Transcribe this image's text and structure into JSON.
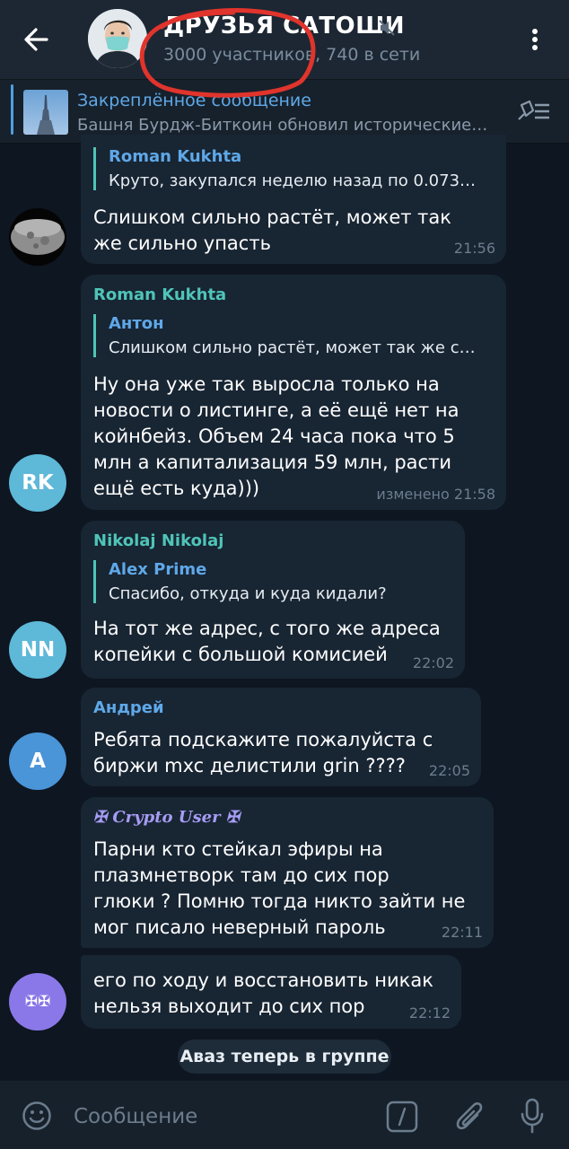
{
  "header": {
    "title": "ДРУЗЬЯ САТОШИ",
    "subtitle": "3000 участников, 740 в сети",
    "back_icon": "arrow-left-icon",
    "muted_icon": "muted-speaker-icon",
    "menu_icon": "more-vertical-icon"
  },
  "pinned": {
    "title": "Закреплённое сообщение",
    "text": "Башня Бурдж-Биткоин обновил исторические…"
  },
  "messages": [
    {
      "sender": "",
      "reply_name": "Roman Kukhta",
      "reply_text": "Круто, закупался неделю назад по 0.073…",
      "text": "Слишком сильно растёт, может так\nже сильно упасть",
      "time": "21:56",
      "avatar_initials": ""
    },
    {
      "sender": "Roman Kukhta",
      "reply_name": "Антон",
      "reply_text": "Слишком сильно растёт, может так же с…",
      "text": "Ну она уже так выросла только на\nновости о листинге, а её ещё нет на\nкойнбейз. Объем 24 часа пока что 5\nмлн а капитализация 59 млн, расти\nещё есть куда)))",
      "time": "изменено 21:58",
      "avatar_initials": "RK"
    },
    {
      "sender": "Nikolaj Nikolaj",
      "reply_name": "Alex Prime",
      "reply_text": "Спасибо, откуда и куда кидали?",
      "text": "На тот же адрес, с того же адреса\nкопейки с большой комисией",
      "time": "22:02",
      "avatar_initials": "NN"
    },
    {
      "sender": "Андрей",
      "text": "Ребята подскажите пожалуйста с\nбиржи mxc  делистили grin ????",
      "time": "22:05",
      "avatar_initials": "A"
    },
    {
      "sender": "✠ Crypto User ✠",
      "text": "Парни кто стейкал эфиры на\nплазмнетворк там до сих пор\nглюки ? Помню тогда никто зайти не\nмог писало неверный пароль",
      "time": "22:11"
    },
    {
      "text": "его по ходу и восстановить никак\nнельзя выходит до сих пор",
      "time": "22:12",
      "avatar_initials": "✠✠"
    }
  ],
  "service_message": "Аваз теперь в группе",
  "input": {
    "placeholder": "Сообщение"
  },
  "colors": {
    "background": "#0e1621",
    "bubble": "#182533",
    "header": "#1c2733",
    "accent": "#5fa8e8",
    "annotation": "#e0342c",
    "sender_teal": "#4fc4b8",
    "sender_purple": "#a69cf4"
  }
}
